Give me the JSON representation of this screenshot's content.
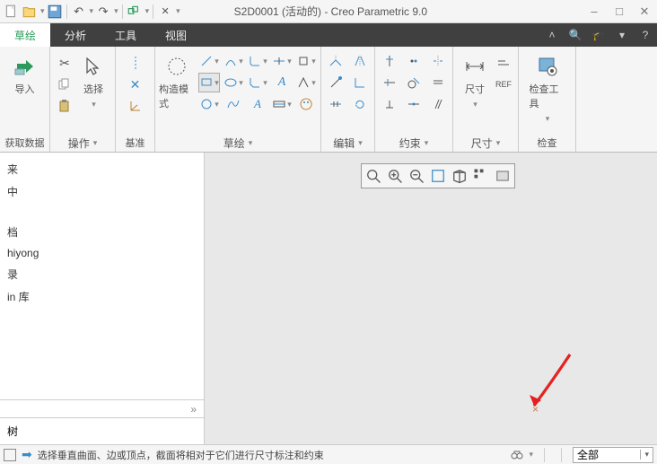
{
  "titlebar": {
    "title": "S2D0001 (活动的) - Creo Parametric 9.0"
  },
  "tabs": {
    "sketch": "草绘",
    "analysis": "分析",
    "tools": "工具",
    "view": "视图"
  },
  "ribbon": {
    "g1_big": "导入",
    "g1_label": "获取数据",
    "g2_big": "选择",
    "g2_label": "操作",
    "g3_label": "基准",
    "g4_big": "构造模式",
    "g4_label": "草绘",
    "g5_label": "编辑",
    "g6_label": "约束",
    "g7_big": "尺寸",
    "g7_label": "尺寸",
    "g8_big": "检查工具",
    "g8_label": "检查"
  },
  "tree": {
    "items": [
      "来",
      "中",
      "档",
      "hiyong",
      "录",
      "in 库"
    ],
    "footer": "树"
  },
  "status": {
    "msg": "选择垂直曲面、边或顶点，截面将相对于它们进行尺寸标注和约束",
    "combo": "全部"
  }
}
